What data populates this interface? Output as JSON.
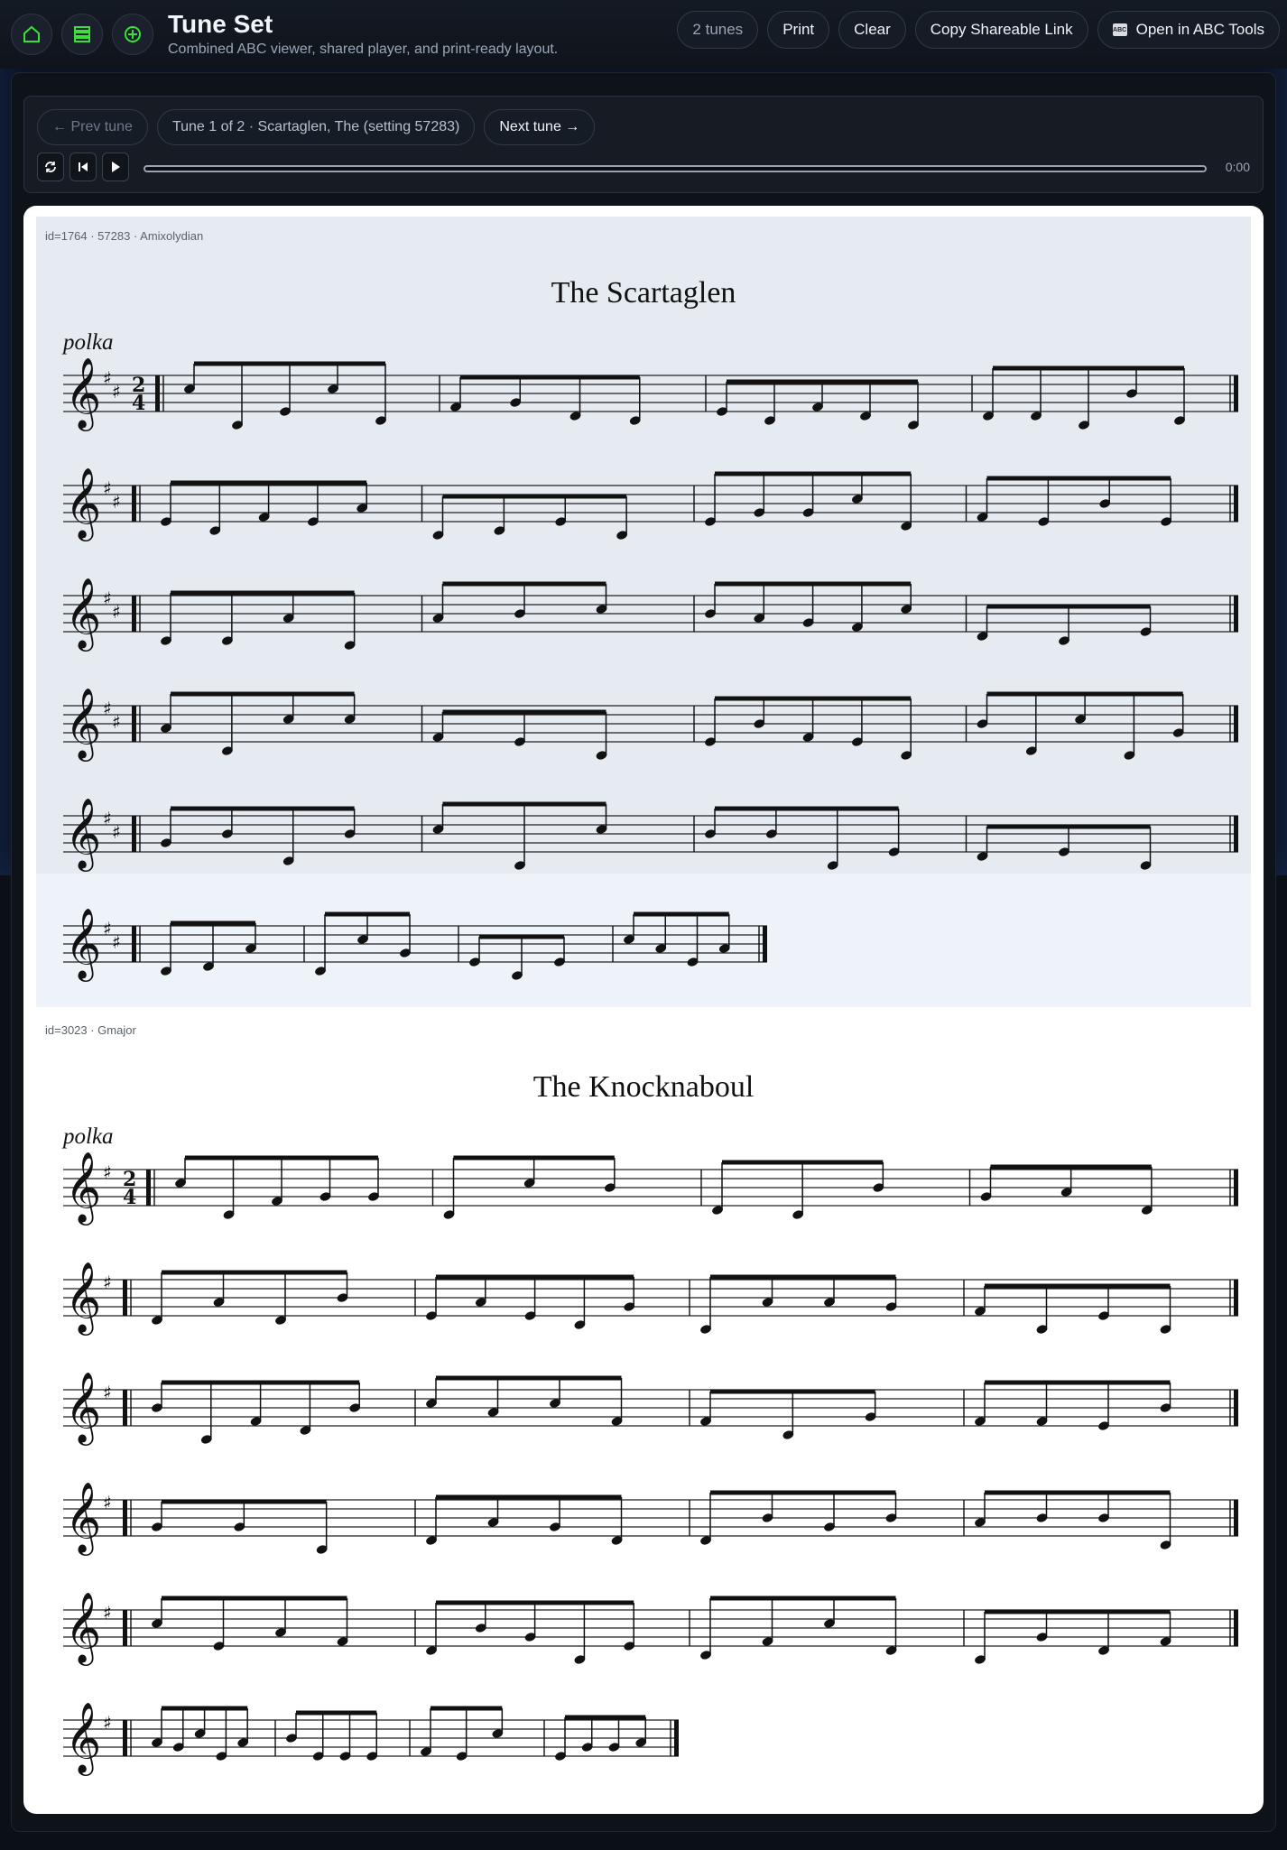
{
  "header": {
    "title": "Tune Set",
    "subtitle": "Combined ABC viewer, shared player, and print-ready layout.",
    "icons": [
      "home-icon",
      "list-icon",
      "add-icon"
    ],
    "tune_count": "2 tunes",
    "print_label": "Print",
    "clear_label": "Clear",
    "copy_link_label": "Copy Shareable Link",
    "open_abc_label": "Open in ABC Tools",
    "abc_badge": "ABC"
  },
  "player": {
    "prev_label": "← Prev tune",
    "current_label": "Tune 1 of 2 · Scartaglen, The (setting 57283)",
    "next_label": "Next tune →",
    "time": "0:00",
    "progress": 0,
    "controls": [
      "loop-icon",
      "restart-icon",
      "play-icon"
    ]
  },
  "tunes": [
    {
      "meta": "id=1764 · 57283 · Amixolydian",
      "title": "The Scartaglen",
      "tempo": "polka",
      "time_signature": "2/4",
      "key_sharps": 2,
      "systems": 6
    },
    {
      "meta": "id=3023 · Gmajor",
      "title": "The Knocknaboul",
      "tempo": "polka",
      "time_signature": "2/4",
      "key_sharps": 1,
      "systems": 6
    }
  ]
}
